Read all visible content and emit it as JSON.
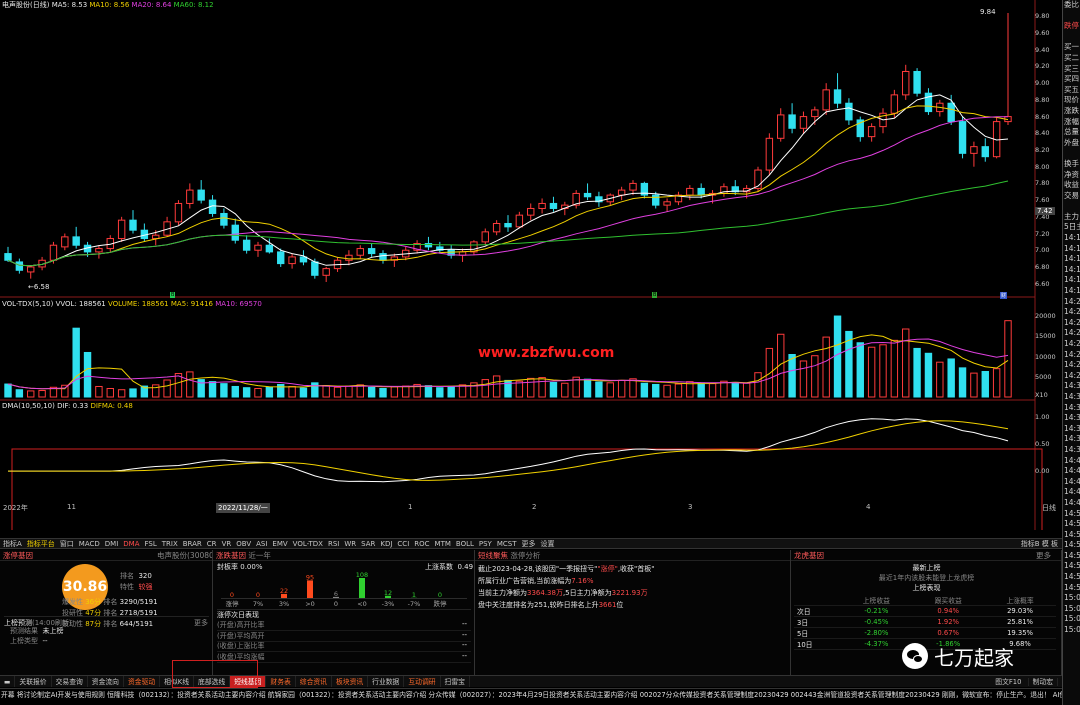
{
  "main_legend": {
    "title": "电声股份(日线)",
    "ma5": "MA5: 8.53",
    "ma10": "MA10: 8.56",
    "ma20": "MA20: 8.64",
    "ma60": "MA60: 8.12"
  },
  "price_axis": [
    "9.80",
    "9.60",
    "9.40",
    "9.20",
    "9.00",
    "8.80",
    "8.60",
    "8.40",
    "8.20",
    "8.00",
    "7.80",
    "7.60",
    "7.40",
    "7.20",
    "7.00",
    "6.80",
    "6.60"
  ],
  "price_high_label": "9.84",
  "price_low_label": "6.58",
  "price_current": "7.42",
  "vol_legend": {
    "title": "VOL-TDX(5,10)",
    "vvol": "VVOL: 188561",
    "volume": "VOLUME: 188561",
    "ma5": "MA5: 91416",
    "ma10": "MA10: 69570"
  },
  "vol_axis": [
    "20000",
    "15000",
    "10000",
    "5000"
  ],
  "vol_unit": "X10",
  "watermark": "www.zbzfwu.com",
  "dma_legend": {
    "title": "DMA(10,50,10)",
    "dif": "DIF: 0.33",
    "difma": "DIFMA: 0.48"
  },
  "dma_axis": [
    "1.00",
    "0.50",
    "0.00"
  ],
  "x_axis": {
    "start": "2022年",
    "m11": "11",
    "sel": "2022/11/28/一",
    "m1": "1",
    "m2": "2",
    "m3": "3",
    "m4": "4",
    "end": "日线"
  },
  "toolbar": [
    "指标A",
    "指标平台",
    "窗口",
    "MACD",
    "DMI",
    "DMA",
    "FSL",
    "TRIX",
    "BRAR",
    "CR",
    "VR",
    "OBV",
    "ASI",
    "EMV",
    "VOL-TDX",
    "RSI",
    "WR",
    "SAR",
    "KDJ",
    "CCI",
    "ROC",
    "MTM",
    "BOLL",
    "PSY",
    "MCST",
    "更多",
    "设置"
  ],
  "toolbar_right": [
    "指标B",
    "模",
    "板"
  ],
  "p1": {
    "title": "涨停基因",
    "stock": "电声股份(300805)",
    "score": "30.86",
    "rank_label": "排名",
    "rank": "320",
    "trait_label": "特性",
    "trait": "较强",
    "rows": [
      {
        "name": "爆发性",
        "pct": "36分",
        "rl": "排名",
        "rv": "3290/5191"
      },
      {
        "name": "投研性",
        "pct": "47分",
        "rl": "排名",
        "rv": "2718/5191"
      },
      {
        "name": "波动性",
        "pct": "87分",
        "rl": "排名",
        "rv": "644/5191"
      }
    ],
    "forecast_title": "上榜预测",
    "forecast_time": "(14:00刷新)",
    "more": "更多",
    "f1l": "预测结果",
    "f1v": "未上榜",
    "f2l": "上榜类型",
    "f2v": "--"
  },
  "p2": {
    "title": "涨跌基因",
    "sub": "近一年",
    "seal_label": "封板率",
    "seal": "0.00%",
    "coef_label": "上涨系数",
    "coef": "0.49",
    "bars": [
      {
        "label": "涨停",
        "value": "0"
      },
      {
        "label": "7%",
        "value": "0"
      },
      {
        "label": "3%",
        "value": "22"
      },
      {
        "label": ">0",
        "value": "95"
      },
      {
        "label": "0",
        "value": "6"
      },
      {
        "label": "<0",
        "value": "108"
      },
      {
        "label": "-3%",
        "value": "12"
      },
      {
        "label": "-7%",
        "value": "1"
      },
      {
        "label": "跌停",
        "value": "0"
      }
    ],
    "next_title": "涨停次日表现",
    "next": [
      {
        "k": "(开盘)高开比率",
        "v": "--"
      },
      {
        "k": "(开盘)平均高开",
        "v": "--"
      },
      {
        "k": "(收盘)上涨比率",
        "v": "--"
      },
      {
        "k": "(收盘)平均涨幅",
        "v": "--"
      }
    ]
  },
  "p3": {
    "title": "短线聚焦",
    "sub": "涨停分析",
    "l1a": "截止2023-04-28,该股因\"一季报扭亏\"",
    "l1b": "\"涨停\"",
    "l1c": ",收获\"首板\"",
    "l2a": "所属行业广告营销,当前涨幅为",
    "l2b": "7.16%",
    "l3a": "当前主力净额为",
    "l3b": "3364.38万",
    "l3c": ",5日主力净额为",
    "l3d": "3221.93万",
    "l4a": "盘中关注度排名为251,较昨日排名上升",
    "l4b": "3661",
    "l4c": "位"
  },
  "p4": {
    "title": "龙虎基因",
    "more": "更多",
    "latest": "最新上榜",
    "none": "最近1年内该股未能登上龙虎榜",
    "perf": "上榜表现",
    "headers": [
      "",
      "上榜收益",
      "跟买收益",
      "上涨概率"
    ],
    "rows": [
      [
        "次日",
        "-0.21%",
        "0.94%",
        "29.03%"
      ],
      [
        "3日",
        "-0.45%",
        "1.92%",
        "25.81%"
      ],
      [
        "5日",
        "-2.80%",
        "0.67%",
        "19.35%"
      ],
      [
        "10日",
        "-4.37%",
        "-1.86%",
        "9.68%"
      ]
    ]
  },
  "bottom_tabs": [
    "关联报价",
    "交易查询",
    "资金流向",
    "资金驱动",
    "相似K线",
    "底部选线",
    "短线基因",
    "财务表",
    "综合资讯",
    "板块资讯",
    "行业数据",
    "互动调研",
    "扫雷宝"
  ],
  "bottom_right": [
    "图文F10",
    "制动宏"
  ],
  "badge": "七万起家",
  "ticker": "开幕 将讨论制定AI开发与使用规则    恒隆科技（002132）：投资者关系活动主要内容介绍    航锦家园（001322）：投资者关系活动主要内容介绍    分众传媒（002027）：2023年4月29日投资者关系活动主要内容介绍    002027分众传媒投资者关系管理制度20230429    002443金洲管道投资者关系管理制度20230429    刚刚，微软宣布：停止生产。退出！ AI使用",
  "right_panel": [
    "委比",
    "",
    "跌停",
    "",
    "买一",
    "买二",
    "买三",
    "买四",
    "买五",
    "现价",
    "涨跌",
    "涨幅",
    "总量",
    "外盘",
    "",
    "换手",
    "净资",
    "收益",
    "交易",
    "",
    "主力",
    "5日主",
    "14:1",
    "14:1",
    "14:1",
    "14:1",
    "14:1",
    "14:1",
    "14:2",
    "14:2",
    "14:2",
    "14:2",
    "14:2",
    "14:2",
    "14:2",
    "14:2",
    "14:3",
    "14:3",
    "14:3",
    "14:3",
    "14:3",
    "14:3",
    "14:3",
    "14:4",
    "14:4",
    "14:4",
    "14:4",
    "14:4",
    "14:5",
    "14:5",
    "14:5",
    "14:5",
    "14:5",
    "14:5",
    "14:5",
    "14:5",
    "15:0",
    "15:0",
    "15:0",
    "15:0"
  ],
  "colors": {
    "up": "#ff3b3b",
    "down": "#30e0f0",
    "ma5": "#ffffff",
    "ma10": "#f0d000",
    "ma20": "#e040e0",
    "ma60": "#30c030"
  },
  "chart_data": {
    "type": "candlestick",
    "title": "电声股份(日线)",
    "ylim": [
      6.5,
      9.9
    ],
    "ohlc": [
      [
        6.96,
        7.04,
        6.86,
        6.88
      ],
      [
        6.86,
        6.9,
        6.72,
        6.76
      ],
      [
        6.74,
        6.82,
        6.66,
        6.8
      ],
      [
        6.8,
        6.92,
        6.76,
        6.88
      ],
      [
        6.88,
        7.1,
        6.84,
        7.06
      ],
      [
        7.04,
        7.2,
        7.0,
        7.16
      ],
      [
        7.16,
        7.28,
        7.02,
        7.06
      ],
      [
        7.06,
        7.1,
        6.92,
        6.98
      ],
      [
        6.98,
        7.06,
        6.9,
        7.02
      ],
      [
        7.02,
        7.18,
        6.98,
        7.14
      ],
      [
        7.14,
        7.4,
        7.1,
        7.36
      ],
      [
        7.36,
        7.48,
        7.2,
        7.24
      ],
      [
        7.24,
        7.32,
        7.1,
        7.14
      ],
      [
        7.14,
        7.24,
        7.06,
        7.18
      ],
      [
        7.18,
        7.4,
        7.16,
        7.34
      ],
      [
        7.34,
        7.6,
        7.3,
        7.56
      ],
      [
        7.56,
        7.8,
        7.5,
        7.72
      ],
      [
        7.72,
        7.84,
        7.56,
        7.6
      ],
      [
        7.6,
        7.66,
        7.4,
        7.44
      ],
      [
        7.44,
        7.5,
        7.26,
        7.3
      ],
      [
        7.3,
        7.38,
        7.08,
        7.12
      ],
      [
        7.12,
        7.18,
        6.96,
        7.0
      ],
      [
        7.0,
        7.1,
        6.92,
        7.06
      ],
      [
        7.06,
        7.14,
        6.96,
        6.98
      ],
      [
        6.98,
        7.02,
        6.8,
        6.84
      ],
      [
        6.84,
        6.96,
        6.78,
        6.92
      ],
      [
        6.92,
        7.0,
        6.82,
        6.86
      ],
      [
        6.86,
        6.9,
        6.66,
        6.7
      ],
      [
        6.7,
        6.8,
        6.62,
        6.78
      ],
      [
        6.78,
        6.92,
        6.74,
        6.88
      ],
      [
        6.88,
        7.0,
        6.82,
        6.94
      ],
      [
        6.94,
        7.06,
        6.9,
        7.02
      ],
      [
        7.02,
        7.08,
        6.92,
        6.96
      ],
      [
        6.96,
        7.0,
        6.84,
        6.88
      ],
      [
        6.88,
        6.96,
        6.8,
        6.92
      ],
      [
        6.92,
        7.04,
        6.88,
        7.0
      ],
      [
        7.0,
        7.12,
        6.96,
        7.08
      ],
      [
        7.08,
        7.16,
        7.0,
        7.04
      ],
      [
        7.04,
        7.1,
        6.96,
        7.0
      ],
      [
        7.0,
        7.06,
        6.9,
        6.94
      ],
      [
        6.94,
        7.02,
        6.86,
        6.98
      ],
      [
        6.98,
        7.12,
        6.94,
        7.1
      ],
      [
        7.1,
        7.26,
        7.06,
        7.22
      ],
      [
        7.22,
        7.36,
        7.18,
        7.32
      ],
      [
        7.32,
        7.42,
        7.22,
        7.28
      ],
      [
        7.28,
        7.46,
        7.26,
        7.42
      ],
      [
        7.42,
        7.56,
        7.36,
        7.5
      ],
      [
        7.5,
        7.62,
        7.44,
        7.56
      ],
      [
        7.56,
        7.64,
        7.46,
        7.5
      ],
      [
        7.5,
        7.58,
        7.42,
        7.54
      ],
      [
        7.54,
        7.72,
        7.5,
        7.68
      ],
      [
        7.68,
        7.8,
        7.6,
        7.64
      ],
      [
        7.64,
        7.7,
        7.52,
        7.58
      ],
      [
        7.58,
        7.68,
        7.54,
        7.66
      ],
      [
        7.66,
        7.76,
        7.6,
        7.72
      ],
      [
        7.72,
        7.84,
        7.66,
        7.8
      ],
      [
        7.8,
        7.82,
        7.62,
        7.66
      ],
      [
        7.66,
        7.7,
        7.5,
        7.54
      ],
      [
        7.54,
        7.62,
        7.46,
        7.58
      ],
      [
        7.58,
        7.7,
        7.54,
        7.66
      ],
      [
        7.66,
        7.78,
        7.6,
        7.74
      ],
      [
        7.74,
        7.8,
        7.62,
        7.66
      ],
      [
        7.66,
        7.72,
        7.56,
        7.68
      ],
      [
        7.68,
        7.8,
        7.64,
        7.76
      ],
      [
        7.76,
        7.84,
        7.66,
        7.7
      ],
      [
        7.7,
        7.78,
        7.62,
        7.74
      ],
      [
        7.74,
        8.0,
        7.7,
        7.96
      ],
      [
        7.96,
        8.4,
        7.9,
        8.34
      ],
      [
        8.34,
        8.7,
        8.3,
        8.62
      ],
      [
        8.62,
        8.76,
        8.4,
        8.46
      ],
      [
        8.46,
        8.66,
        8.4,
        8.6
      ],
      [
        8.6,
        8.72,
        8.5,
        8.68
      ],
      [
        8.68,
        9.0,
        8.62,
        8.92
      ],
      [
        8.92,
        9.12,
        8.7,
        8.76
      ],
      [
        8.76,
        8.82,
        8.5,
        8.56
      ],
      [
        8.56,
        8.6,
        8.3,
        8.36
      ],
      [
        8.36,
        8.52,
        8.3,
        8.48
      ],
      [
        8.48,
        8.7,
        8.4,
        8.64
      ],
      [
        8.64,
        8.92,
        8.58,
        8.86
      ],
      [
        8.86,
        9.22,
        8.8,
        9.14
      ],
      [
        9.14,
        9.18,
        8.84,
        8.88
      ],
      [
        8.88,
        8.94,
        8.62,
        8.66
      ],
      [
        8.66,
        8.8,
        8.6,
        8.76
      ],
      [
        8.76,
        8.86,
        8.5,
        8.54
      ],
      [
        8.54,
        8.6,
        8.1,
        8.16
      ],
      [
        8.16,
        8.3,
        8.0,
        8.24
      ],
      [
        8.24,
        8.34,
        8.06,
        8.12
      ],
      [
        8.12,
        8.6,
        8.1,
        8.54
      ],
      [
        8.54,
        9.84,
        8.5,
        8.6
      ]
    ],
    "volume_x10": [
      3200,
      1800,
      1500,
      1600,
      2400,
      2900,
      17000,
      11000,
      2600,
      2100,
      1800,
      2000,
      2700,
      3000,
      4200,
      5800,
      6200,
      4300,
      3800,
      3300,
      2600,
      2300,
      2100,
      2400,
      3100,
      2600,
      2200,
      3500,
      2800,
      2400,
      2700,
      3000,
      2400,
      2100,
      2500,
      2700,
      3100,
      2800,
      2300,
      2600,
      3000,
      3500,
      4300,
      5200,
      4100,
      3900,
      4600,
      4800,
      3600,
      3400,
      4900,
      4400,
      3700,
      3500,
      4100,
      4500,
      3400,
      3100,
      2900,
      3200,
      3800,
      3500,
      3300,
      3900,
      3600,
      3400,
      6000,
      12000,
      15500,
      10500,
      8900,
      10200,
      14800,
      20000,
      16200,
      13400,
      12300,
      12900,
      14000,
      16800,
      12000,
      10800,
      8600,
      9400,
      7200,
      5900,
      6300,
      7000,
      18856
    ]
  }
}
